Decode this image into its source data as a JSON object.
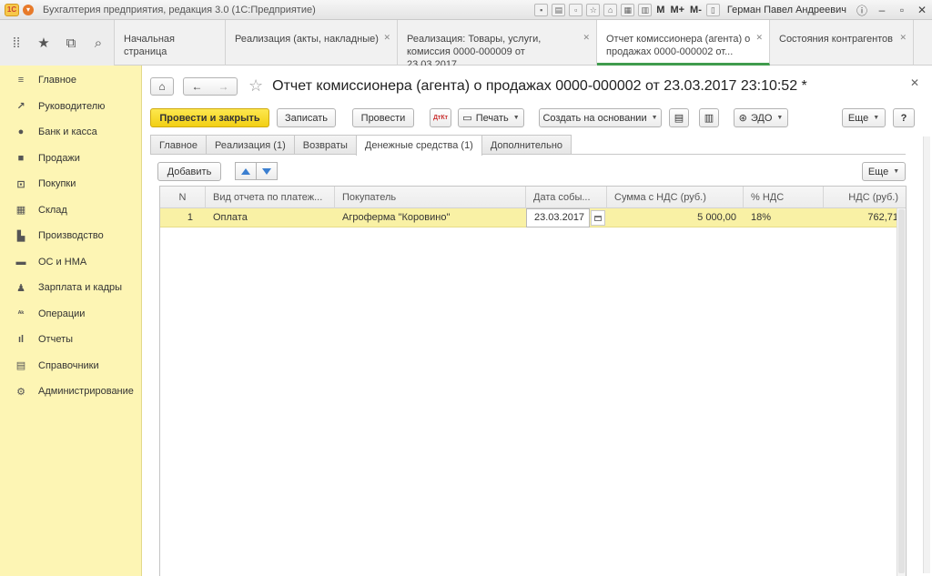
{
  "window": {
    "title": "Бухгалтерия предприятия, редакция 3.0  (1С:Предприятие)",
    "logo_text": "1С",
    "memory_buttons": [
      "M",
      "M+",
      "M-"
    ],
    "user": "Герман Павел Андреевич"
  },
  "tabs": [
    {
      "label": "Начальная страница",
      "closable": false
    },
    {
      "label": "Реализация (акты, накладные)",
      "closable": true
    },
    {
      "label": "Реализация: Товары, услуги, комиссия 0000-000009 от 23.03.2017...",
      "closable": true
    },
    {
      "label": "Отчет комиссионера (агента) о продажах 0000-000002 от...",
      "closable": true,
      "active": true
    },
    {
      "label": "Состояния контрагентов",
      "closable": true
    }
  ],
  "sidebar": {
    "items": [
      {
        "label": "Главное",
        "icon": "menu-icon"
      },
      {
        "label": "Руководителю",
        "icon": "trend-icon"
      },
      {
        "label": "Банк и касса",
        "icon": "coin-icon"
      },
      {
        "label": "Продажи",
        "icon": "bag-icon"
      },
      {
        "label": "Покупки",
        "icon": "cart-icon"
      },
      {
        "label": "Склад",
        "icon": "grid-icon"
      },
      {
        "label": "Производство",
        "icon": "factory-icon"
      },
      {
        "label": "ОС и НМА",
        "icon": "truck-icon"
      },
      {
        "label": "Зарплата и кадры",
        "icon": "person-icon"
      },
      {
        "label": "Операции",
        "icon": "dt-kt-icon"
      },
      {
        "label": "Отчеты",
        "icon": "bar-chart-icon"
      },
      {
        "label": "Справочники",
        "icon": "book-icon"
      },
      {
        "label": "Администрирование",
        "icon": "gear-icon"
      }
    ]
  },
  "form": {
    "title": "Отчет комиссионера (агента) о продажах 0000-000002 от 23.03.2017 23:10:52 *",
    "toolbar": {
      "post_and_close": "Провести и закрыть",
      "save": "Записать",
      "post": "Провести",
      "dtkt": "ДтКт",
      "print": "Печать",
      "create_based": "Создать на основании",
      "edo": "ЭДО",
      "more": "Еще",
      "help": "?"
    },
    "subtabs": [
      "Главное",
      "Реализация (1)",
      "Возвраты",
      "Денежные средства (1)",
      "Дополнительно"
    ],
    "active_subtab": 3
  },
  "table": {
    "add_label": "Добавить",
    "more_label": "Еще",
    "columns": [
      "N",
      "Вид отчета по платеж...",
      "Покупатель",
      "Дата собы...",
      "Сумма с НДС (руб.)",
      "% НДС",
      "НДС (руб.)"
    ],
    "rows": [
      {
        "n": "1",
        "kind": "Оплата",
        "buyer": "Агроферма \"Коровино\"",
        "date": "23.03.2017",
        "sum": "5 000,00",
        "vat_rate": "18%",
        "vat": "762,71"
      }
    ]
  }
}
